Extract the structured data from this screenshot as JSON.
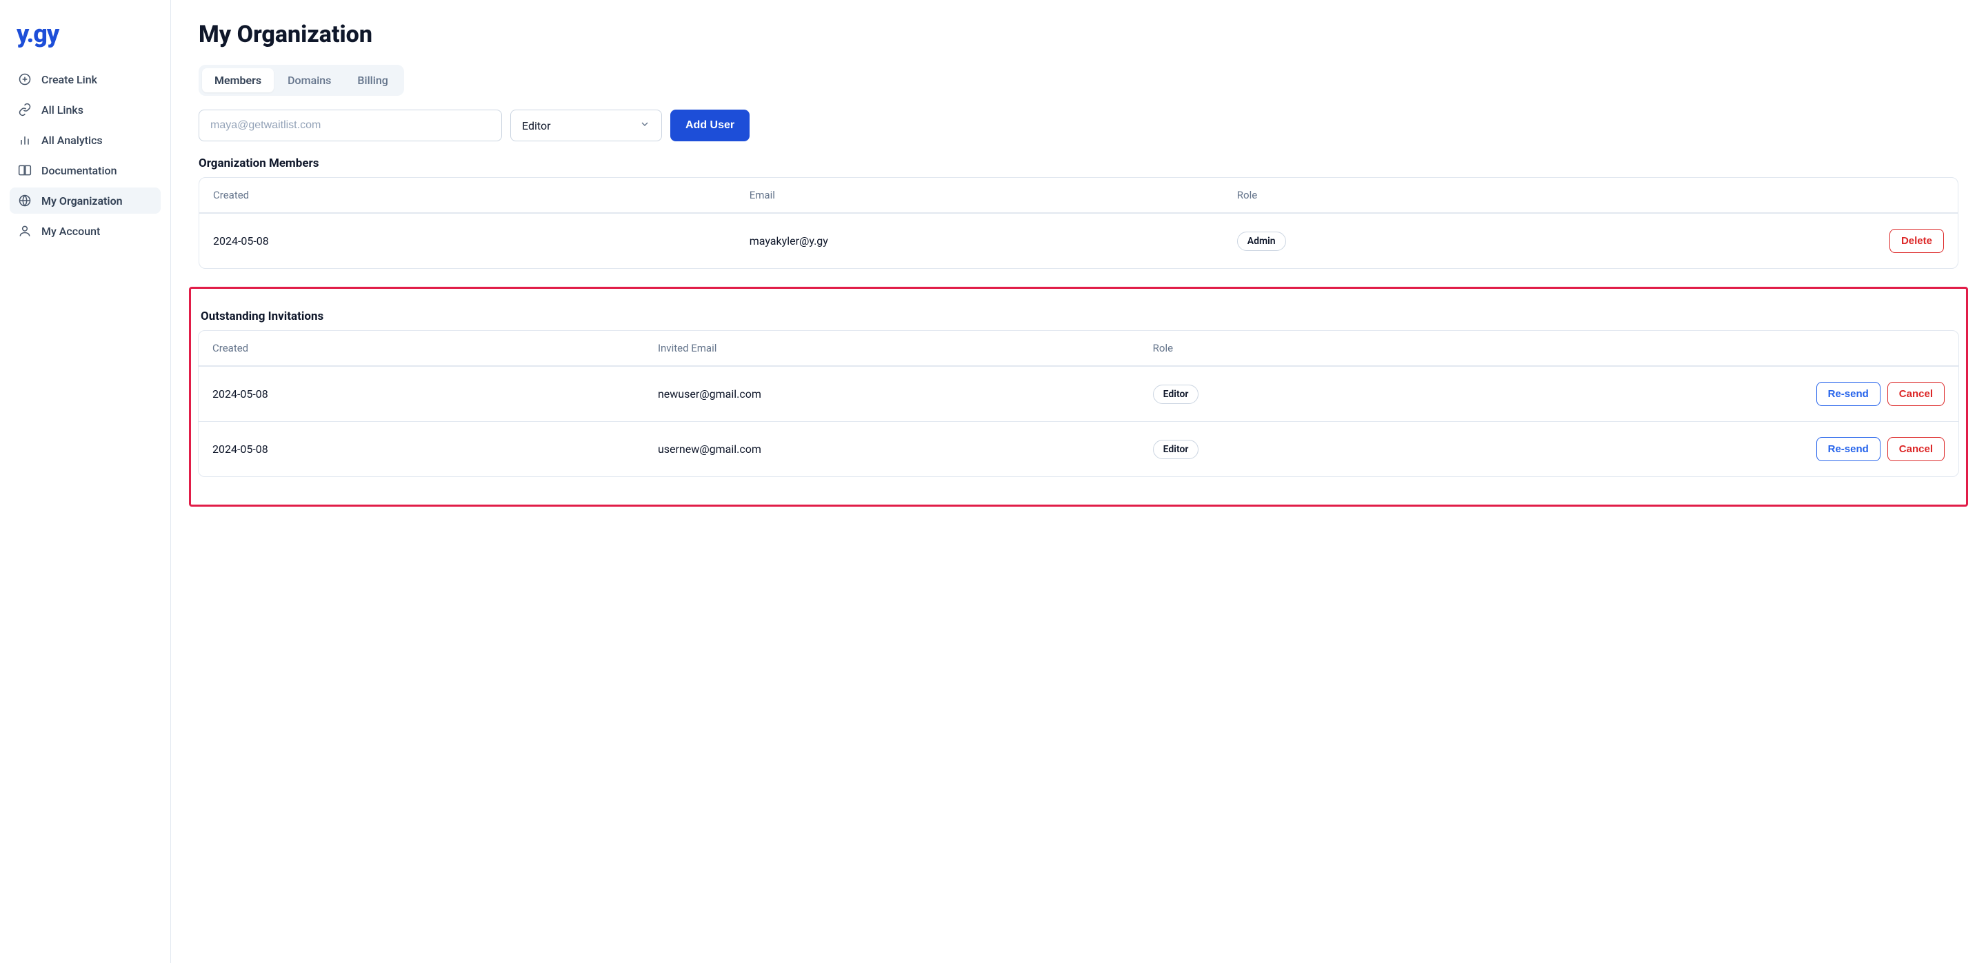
{
  "brand": {
    "logo_text": "y.gy"
  },
  "sidebar": {
    "items": [
      {
        "label": "Create Link"
      },
      {
        "label": "All Links"
      },
      {
        "label": "All Analytics"
      },
      {
        "label": "Documentation"
      },
      {
        "label": "My Organization"
      },
      {
        "label": "My Account"
      }
    ]
  },
  "page": {
    "title": "My Organization"
  },
  "tabs": {
    "members": "Members",
    "domains": "Domains",
    "billing": "Billing"
  },
  "add_form": {
    "email_placeholder": "maya@getwaitlist.com",
    "role_selected": "Editor",
    "add_button": "Add User"
  },
  "members_section": {
    "title": "Organization Members",
    "columns": {
      "created": "Created",
      "email": "Email",
      "role": "Role"
    },
    "rows": [
      {
        "created": "2024-05-08",
        "email": "mayakyler@y.gy",
        "role": "Admin"
      }
    ],
    "delete_label": "Delete"
  },
  "invites_section": {
    "title": "Outstanding Invitations",
    "columns": {
      "created": "Created",
      "email": "Invited Email",
      "role": "Role"
    },
    "rows": [
      {
        "created": "2024-05-08",
        "email": "newuser@gmail.com",
        "role": "Editor"
      },
      {
        "created": "2024-05-08",
        "email": "usernew@gmail.com",
        "role": "Editor"
      }
    ],
    "resend_label": "Re-send",
    "cancel_label": "Cancel"
  }
}
